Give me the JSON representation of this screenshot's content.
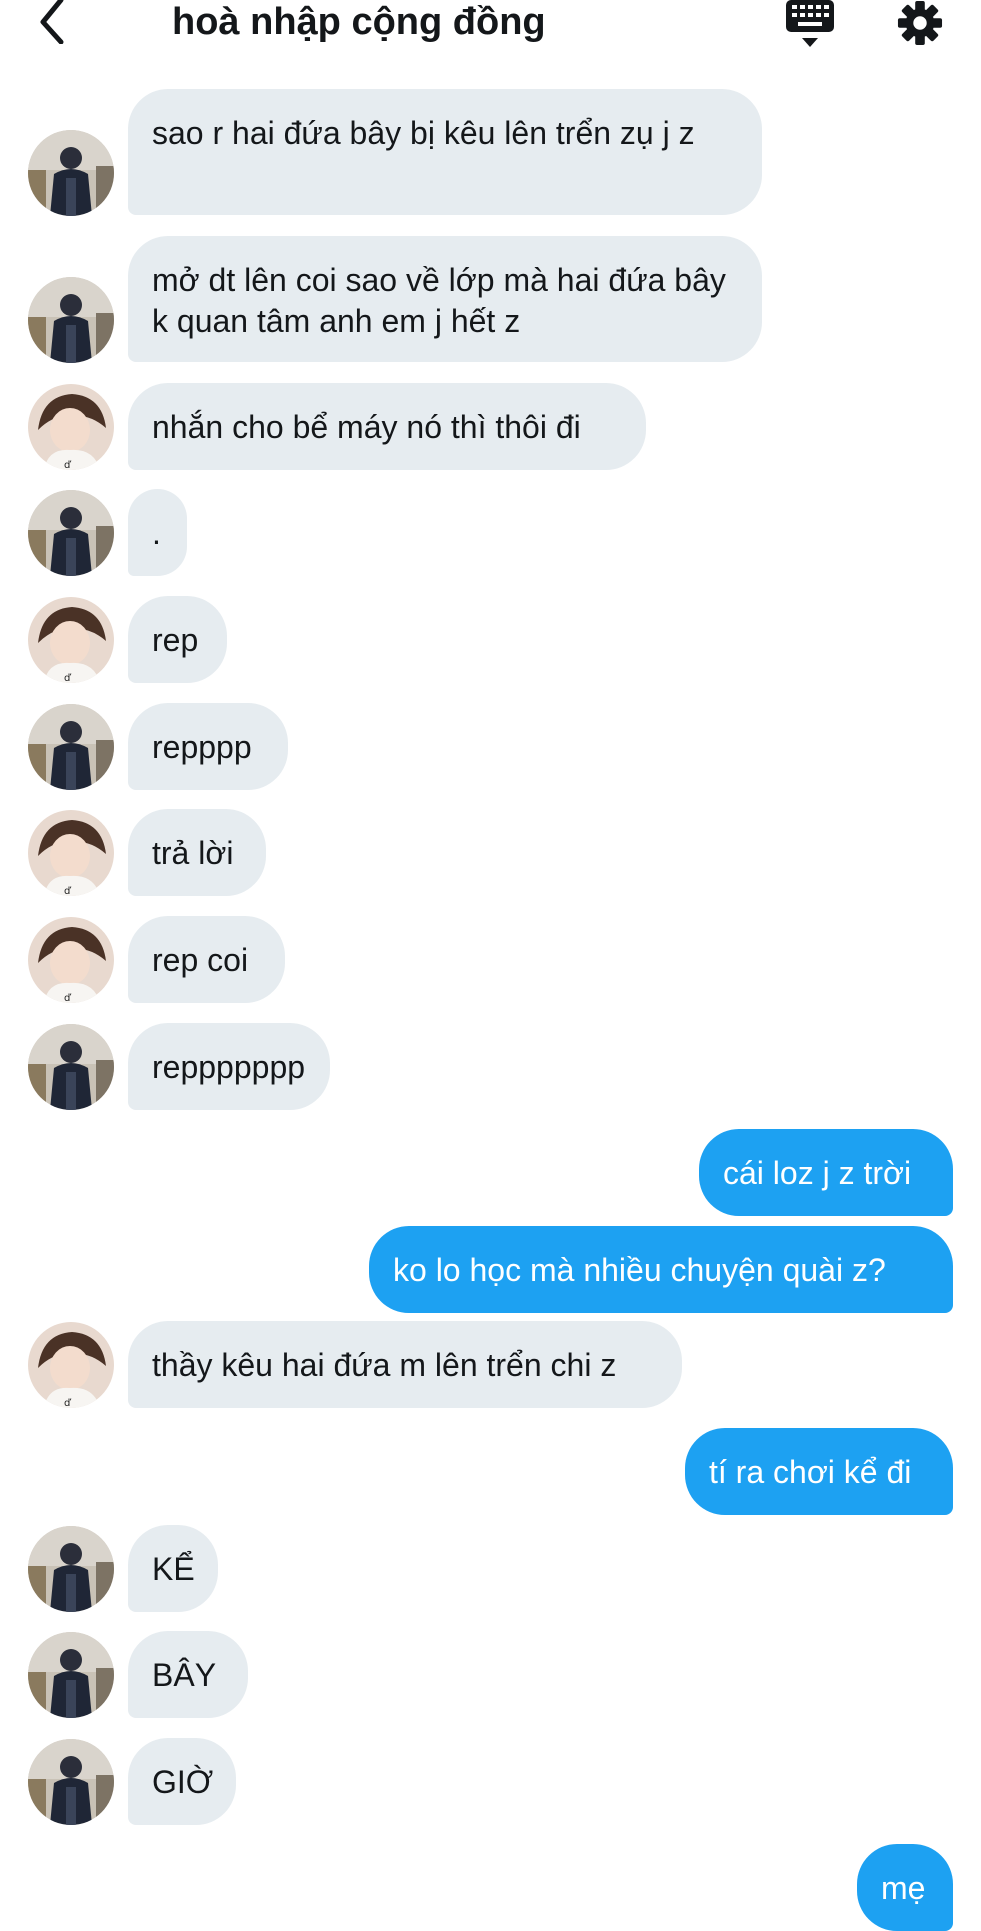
{
  "header": {
    "title": "hoà nhập cộng đồng",
    "back_icon": "chevron-left-icon",
    "keyboard_icon": "keyboard-icon",
    "settings_icon": "gear-icon"
  },
  "colors": {
    "accent": "#1da1f2",
    "incoming_bubble": "#e6ecf0",
    "text": "#14171a"
  },
  "messages": [
    {
      "direction": "in",
      "sender": "a",
      "text": "sao r hai đứa bây bị kêu lên trển zụ j z"
    },
    {
      "direction": "in",
      "sender": "a",
      "text": "mở dt lên coi sao về lớp mà hai đứa bây k quan tâm anh em j hết z"
    },
    {
      "direction": "in",
      "sender": "b",
      "text": "nhắn cho bể máy nó thì thôi đi"
    },
    {
      "direction": "in",
      "sender": "a",
      "text": "."
    },
    {
      "direction": "in",
      "sender": "b",
      "text": "rep"
    },
    {
      "direction": "in",
      "sender": "a",
      "text": "repppp"
    },
    {
      "direction": "in",
      "sender": "b",
      "text": "trả lời"
    },
    {
      "direction": "in",
      "sender": "b",
      "text": "rep coi"
    },
    {
      "direction": "in",
      "sender": "a",
      "text": "reppppppp"
    },
    {
      "direction": "out",
      "text": "cái loz j z trời"
    },
    {
      "direction": "out",
      "text": "ko lo học mà nhiều chuyện quài z?"
    },
    {
      "direction": "in",
      "sender": "b",
      "text": "thầy kêu hai đứa m lên trển chi z"
    },
    {
      "direction": "out",
      "text": "tí ra chơi kể đi"
    },
    {
      "direction": "in",
      "sender": "a",
      "text": "KỂ"
    },
    {
      "direction": "in",
      "sender": "a",
      "text": "BÂY"
    },
    {
      "direction": "in",
      "sender": "a",
      "text": "GIỜ"
    },
    {
      "direction": "out",
      "text": "mẹ"
    }
  ]
}
